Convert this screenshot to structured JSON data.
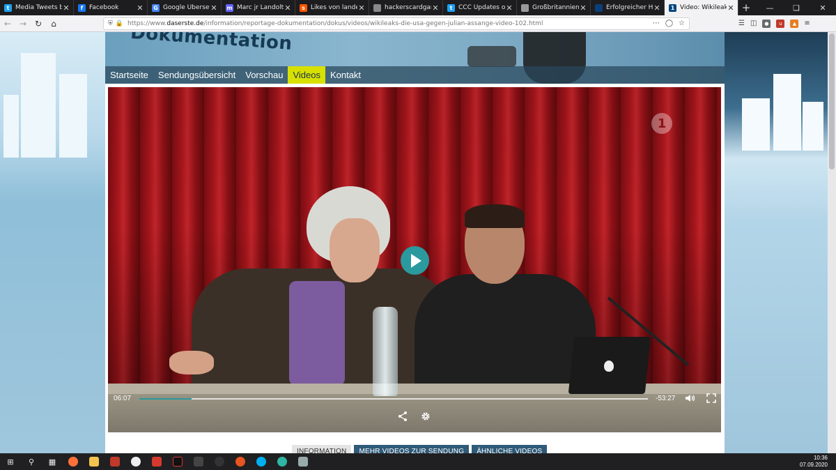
{
  "browser": {
    "tabs": [
      {
        "title": "Media Tweets by Ma",
        "favicon_color": "#1da1f2",
        "glyph": "t"
      },
      {
        "title": "Facebook",
        "favicon_color": "#1877f2",
        "glyph": "f"
      },
      {
        "title": "Google Übersetzer",
        "favicon_color": "#4285f4",
        "glyph": "G"
      },
      {
        "title": "Marc jr Landolt (@la",
        "favicon_color": "#6364ff",
        "glyph": "m"
      },
      {
        "title": "Likes von landev auf",
        "favicon_color": "#ff5500",
        "glyph": "s"
      },
      {
        "title": "hackerscardgame.ch/jpg",
        "favicon_color": "#888888",
        "glyph": ""
      },
      {
        "title": "CCC Updates on Twi",
        "favicon_color": "#1da1f2",
        "glyph": "t"
      },
      {
        "title": "Großbritannien: Mut",
        "favicon_color": "#999999",
        "glyph": ""
      },
      {
        "title": "Erfolgreicher Hackin",
        "favicon_color": "#0b3e7a",
        "glyph": ""
      },
      {
        "title": "Video: Wikileaks - Re",
        "favicon_color": "#00467f",
        "glyph": "1",
        "active": true
      }
    ],
    "url_prefix": "https://www.",
    "url_domain": "daserste.de",
    "url_path": "/information/reportage-dokumentation/dokus/videos/wikileaks-die-usa-gegen-julian-assange-video-102.html"
  },
  "site": {
    "brand": "Dokumentation",
    "nav": [
      {
        "label": "Startseite",
        "active": false
      },
      {
        "label": "Sendungsübersicht",
        "active": false
      },
      {
        "label": "Vorschau",
        "active": false
      },
      {
        "label": "Videos",
        "active": true
      },
      {
        "label": "Kontakt",
        "active": false
      }
    ]
  },
  "player": {
    "channel_logo": "1",
    "time_current": "06:07",
    "time_remaining": "-53:27",
    "progress_fraction": 0.103,
    "accent_color": "#2a9a9e"
  },
  "info_tabs": [
    {
      "label": "INFORMATION",
      "style": "light"
    },
    {
      "label": "MEHR VIDEOS ZUR SENDUNG",
      "style": "dark"
    },
    {
      "label": "ÄHNLICHE VIDEOS",
      "style": "dark"
    }
  ],
  "taskbar": {
    "time": "10:36",
    "date": "07.09.2020"
  }
}
